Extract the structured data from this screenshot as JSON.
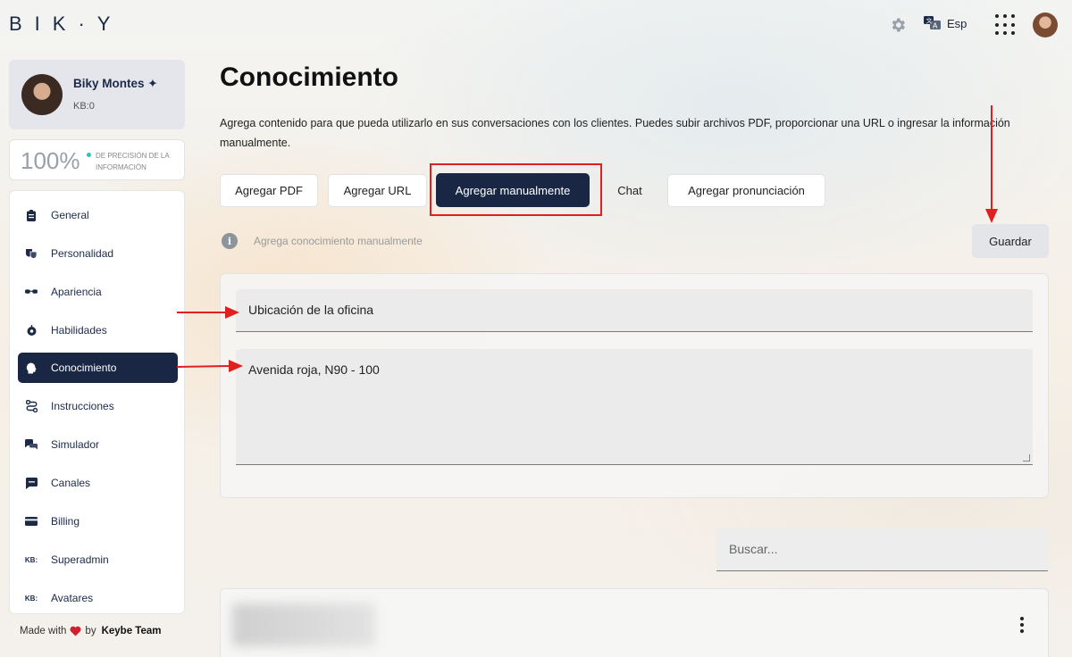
{
  "topbar": {
    "logo": "BIK·Y",
    "language": "Esp",
    "icons": [
      "gear-icon",
      "translate-icon",
      "apps-grid-icon",
      "user-avatar"
    ]
  },
  "sidebar": {
    "profile": {
      "name": "Biky Montes ✦",
      "kb": "KB:0"
    },
    "precision": {
      "value": "100%",
      "label": "DE PRECISIÓN DE LA INFORMACIÓN"
    },
    "items": [
      {
        "label": "General",
        "icon": "clipboard-icon"
      },
      {
        "label": "Personalidad",
        "icon": "theater-masks-icon"
      },
      {
        "label": "Apariencia",
        "icon": "glasses-icon"
      },
      {
        "label": "Habilidades",
        "icon": "brain-gear-icon"
      },
      {
        "label": "Conocimiento",
        "icon": "head-icon",
        "active": true
      },
      {
        "label": "Instrucciones",
        "icon": "route-icon"
      },
      {
        "label": "Simulador",
        "icon": "chat-bubbles-icon"
      },
      {
        "label": "Canales",
        "icon": "message-icon"
      },
      {
        "label": "Billing",
        "icon": "credit-card-icon"
      },
      {
        "label": "Superadmin",
        "icon": "kb-icon",
        "icon_text": "KB:"
      },
      {
        "label": "Avatares",
        "icon": "kb-icon",
        "icon_text": "KB:"
      }
    ],
    "footer": {
      "made_with": "Made with",
      "by": "by",
      "team": "Keybe Team"
    }
  },
  "main": {
    "title": "Conocimiento",
    "description": "Agrega contenido para que pueda utilizarlo en sus conversaciones con los clientes. Puedes subir archivos PDF, proporcionar una URL o ingresar la información manualmente.",
    "tabs": [
      {
        "label": "Agregar PDF"
      },
      {
        "label": "Agregar URL"
      },
      {
        "label": "Agregar manualmente",
        "active": true
      },
      {
        "label": "Chat"
      },
      {
        "label": "Agregar pronunciación"
      }
    ],
    "info_text": "Agrega conocimiento manualmente",
    "save_label": "Guardar",
    "form": {
      "title_value": "Ubicación de la oficina",
      "content_value": "Avenida roja, N90 - 100"
    },
    "search_placeholder": "Buscar...",
    "colors": {
      "primary": "#1a2744",
      "annotation": "#e02020"
    }
  }
}
